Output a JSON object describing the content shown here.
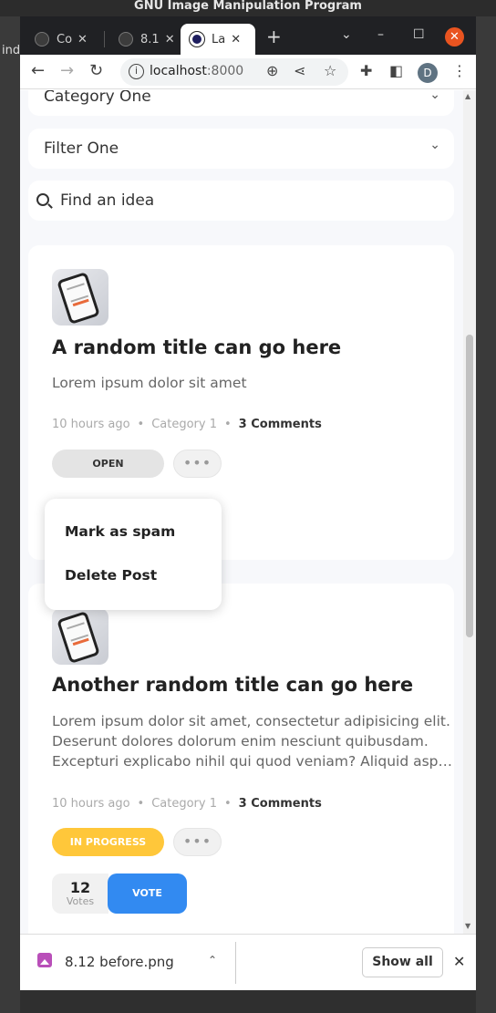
{
  "desktop": {
    "title": "GNU Image Manipulation Program",
    "left_text": "ind"
  },
  "browser": {
    "tabs": [
      {
        "label": "Co",
        "close": "✕"
      },
      {
        "label": "8.1",
        "close": "✕"
      },
      {
        "label": "La",
        "close": "✕"
      }
    ],
    "new_tab": "+",
    "url_host": "localhost",
    "url_port": ":8000",
    "avatar_letter": "D"
  },
  "filters": {
    "category": "Category One",
    "filter": "Filter One",
    "search_placeholder": "Find an idea"
  },
  "ideas": [
    {
      "title": "A random title can go here",
      "description": [
        "Lorem ipsum dolor sit amet"
      ],
      "time": "10 hours ago",
      "category": "Category 1",
      "comments": "3 Comments",
      "status": "OPEN",
      "more": "•••",
      "menu": [
        "Mark as spam",
        "Delete Post"
      ]
    },
    {
      "title": "Another random title can go here",
      "description": [
        "Lorem ipsum dolor sit amet, consectetur adipisicing elit.",
        "Deserunt dolores dolorum enim nesciunt quibusdam.",
        "Excepturi explicabo nihil qui quod veniam? Aliquid asperiores"
      ],
      "time": "10 hours ago",
      "category": "Category 1",
      "comments": "3 Comments",
      "status": "IN PROGRESS",
      "more": "•••",
      "votes": "12",
      "votes_label": "Votes",
      "vote_button": "VOTE"
    }
  ],
  "download": {
    "file": "8.12 before.png",
    "show_all": "Show all"
  },
  "colors": {
    "accent": "#328af1",
    "in_progress": "#ffc73a",
    "open": "#e4e4e4",
    "close_button": "#e95420"
  }
}
